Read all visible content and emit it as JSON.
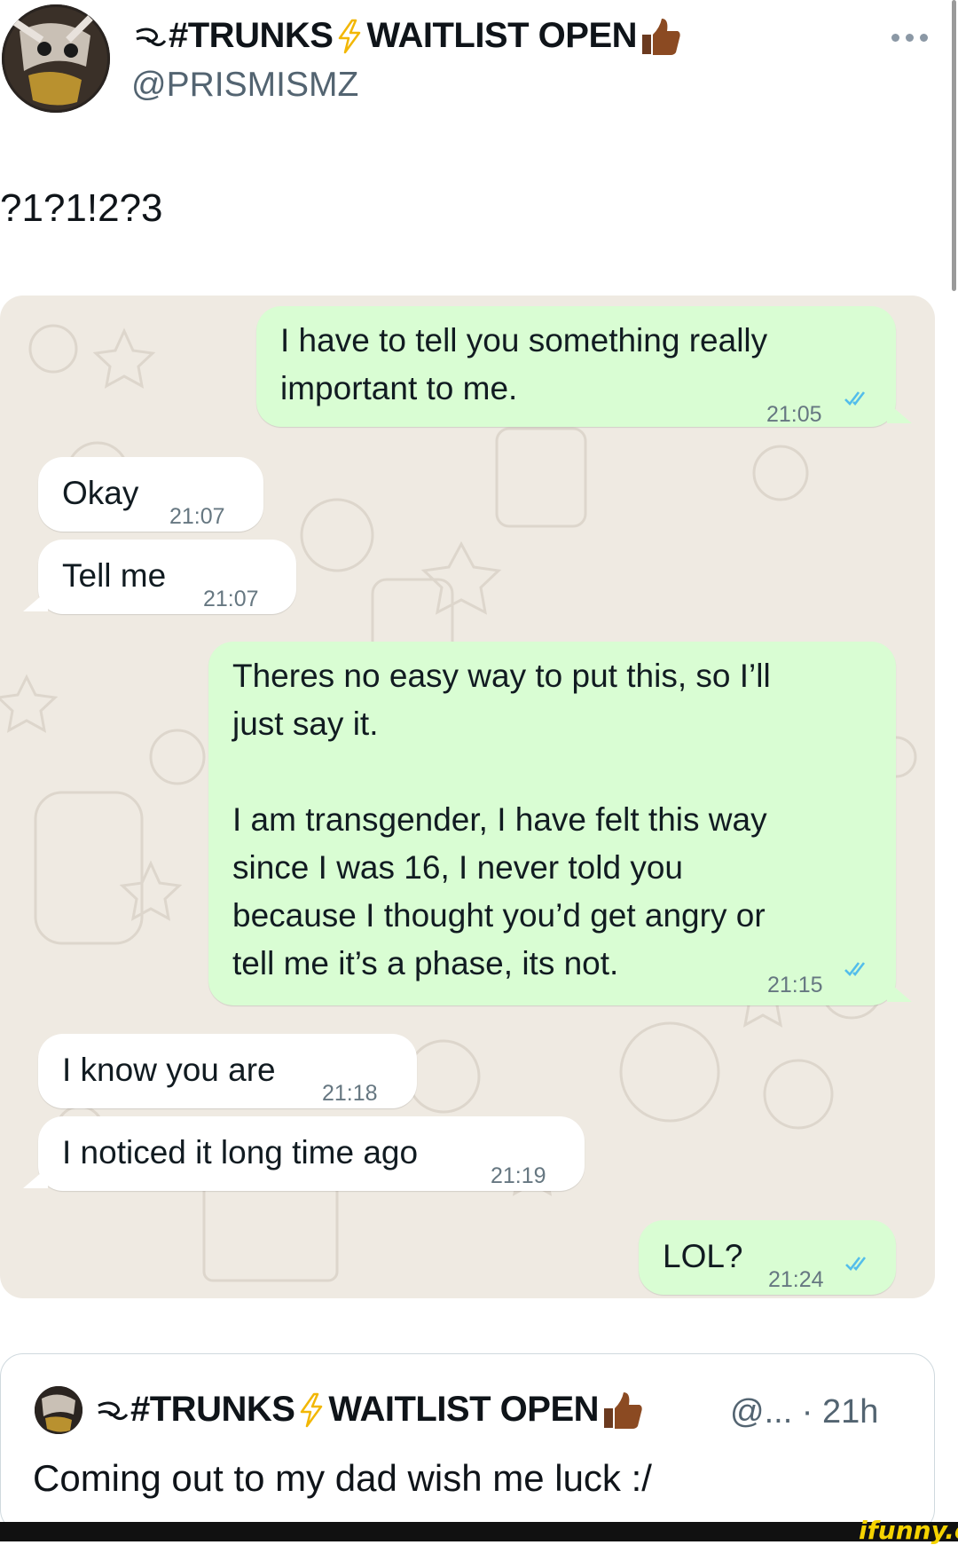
{
  "header": {
    "display_name": "#TRUNKS",
    "display_name_suffix": "WAITLIST OPEN",
    "handle": "@PRISMISMZ",
    "more_icon": "more-horizontal-icon"
  },
  "tweet": {
    "text": "?1?1!2?3"
  },
  "chat": {
    "messages": [
      {
        "direction": "out",
        "lines": [
          "I have to tell you something really",
          "important to me."
        ],
        "time": "21:05",
        "read": true
      },
      {
        "direction": "in",
        "lines": [
          "Okay"
        ],
        "time": "21:07"
      },
      {
        "direction": "in",
        "lines": [
          "Tell me"
        ],
        "time": "21:07"
      },
      {
        "direction": "out",
        "lines": [
          "Theres no easy way to put this, so I’ll",
          "just say it.",
          "",
          "I am transgender, I have felt this way",
          "since I was 16, I never told you",
          "because I thought you’d get angry or",
          "tell me it’s a phase, its not."
        ],
        "time": "21:15",
        "read": true
      },
      {
        "direction": "in",
        "lines": [
          "I know you are"
        ],
        "time": "21:18"
      },
      {
        "direction": "in",
        "lines": [
          "I noticed it long time ago"
        ],
        "time": "21:19"
      },
      {
        "direction": "out",
        "lines": [
          "LOL?"
        ],
        "time": "21:24",
        "read": true
      }
    ],
    "colors": {
      "background": "#efeae2",
      "outgoing": "#d9fdd3",
      "incoming": "#ffffff",
      "ticks": "#53bdeb"
    }
  },
  "quote": {
    "display_name": "#TRUNKS",
    "display_name_suffix": "WAITLIST OPEN",
    "meta": "@... · 21h",
    "text": "Coming out to my dad wish me luck :/"
  },
  "watermark": "ifunny.co"
}
